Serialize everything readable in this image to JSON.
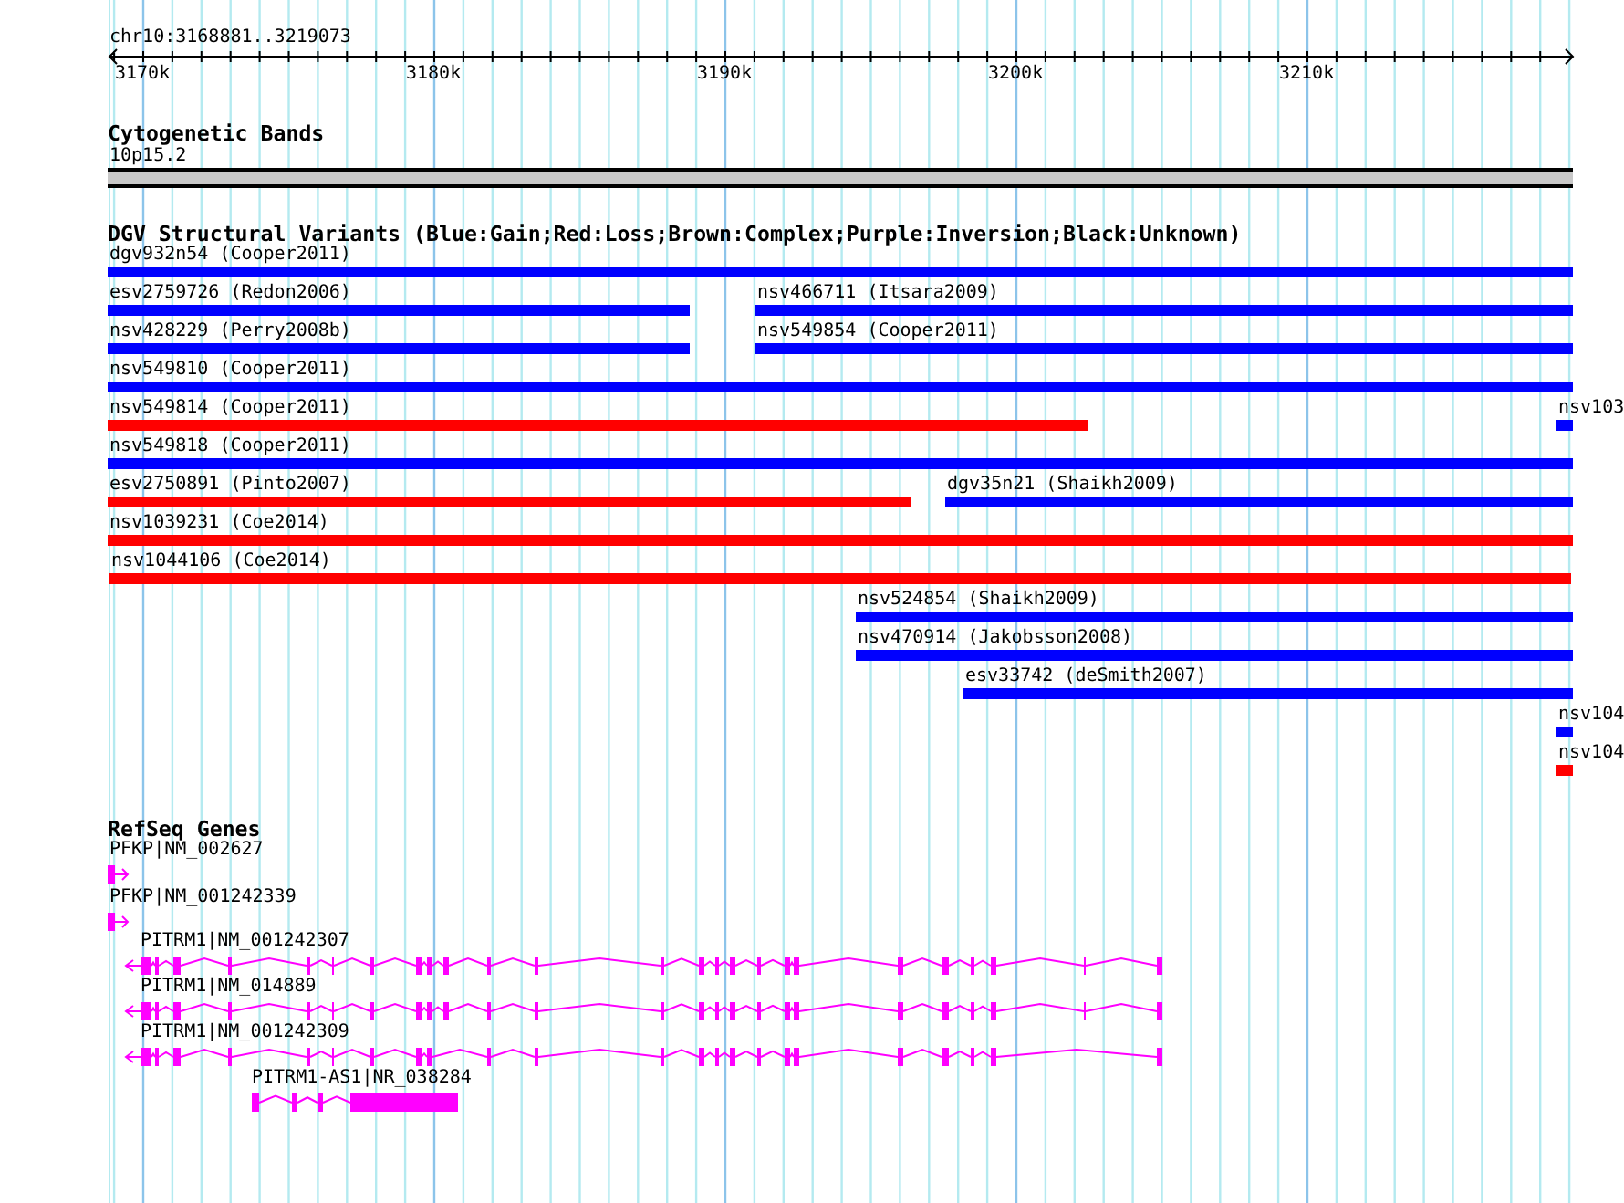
{
  "ruler": {
    "location": "chr10:3168881..3219073",
    "ticks": [
      "3170k",
      "3180k",
      "3190k",
      "3200k",
      "3210k"
    ]
  },
  "cytogenetic_bands": {
    "title": "Cytogenetic Bands",
    "band": {
      "label": "10p15.2",
      "color": "#c8c8c8"
    }
  },
  "dgv_structural_variants": {
    "title": "DGV Structural Variants (Blue:Gain;Red:Loss;Brown:Complex;Purple:Inversion;Black:Unknown)",
    "rows": [
      {
        "features": [
          {
            "label": "dgv932n54 (Cooper2011)",
            "color": "#0000ff"
          }
        ]
      },
      {
        "features": [
          {
            "label": "esv2759726 (Redon2006)",
            "color": "#0000ff"
          },
          {
            "label": "nsv466711 (Itsara2009)",
            "color": "#0000ff"
          }
        ]
      },
      {
        "features": [
          {
            "label": "nsv428229 (Perry2008b)",
            "color": "#0000ff"
          },
          {
            "label": "nsv549854 (Cooper2011)",
            "color": "#0000ff"
          }
        ]
      },
      {
        "features": [
          {
            "label": "nsv549810 (Cooper2011)",
            "color": "#0000ff"
          }
        ]
      },
      {
        "features": [
          {
            "label": "nsv549814 (Cooper2011)",
            "color": "#ff0000"
          },
          {
            "label": "nsv103",
            "color": "#0000ff"
          }
        ]
      },
      {
        "features": [
          {
            "label": "nsv549818 (Cooper2011)",
            "color": "#0000ff"
          }
        ]
      },
      {
        "features": [
          {
            "label": "esv2750891 (Pinto2007)",
            "color": "#ff0000"
          },
          {
            "label": "dgv35n21 (Shaikh2009)",
            "color": "#0000ff"
          }
        ]
      },
      {
        "features": [
          {
            "label": "nsv1039231 (Coe2014)",
            "color": "#ff0000"
          }
        ]
      },
      {
        "features": [
          {
            "label": "nsv1044106 (Coe2014)",
            "color": "#ff0000"
          }
        ]
      },
      {
        "features": [
          {
            "label": "nsv524854 (Shaikh2009)",
            "color": "#0000ff"
          }
        ]
      },
      {
        "features": [
          {
            "label": "nsv470914 (Jakobsson2008)",
            "color": "#0000ff"
          }
        ]
      },
      {
        "features": [
          {
            "label": "esv33742 (deSmith2007)",
            "color": "#0000ff"
          }
        ]
      },
      {
        "features": [
          {
            "label": "nsv104",
            "color": "#0000ff"
          }
        ]
      },
      {
        "features": [
          {
            "label": "nsv104",
            "color": "#ff0000"
          }
        ]
      }
    ]
  },
  "refseq_genes": {
    "title": "RefSeq Genes",
    "genes": [
      {
        "label": "PFKP|NM_002627"
      },
      {
        "label": "PFKP|NM_001242339"
      },
      {
        "label": "PITRM1|NM_001242307"
      },
      {
        "label": "PITRM1|NM_014889"
      },
      {
        "label": "PITRM1|NM_001242309"
      },
      {
        "label": "PITRM1-AS1|NR_038284"
      }
    ]
  }
}
